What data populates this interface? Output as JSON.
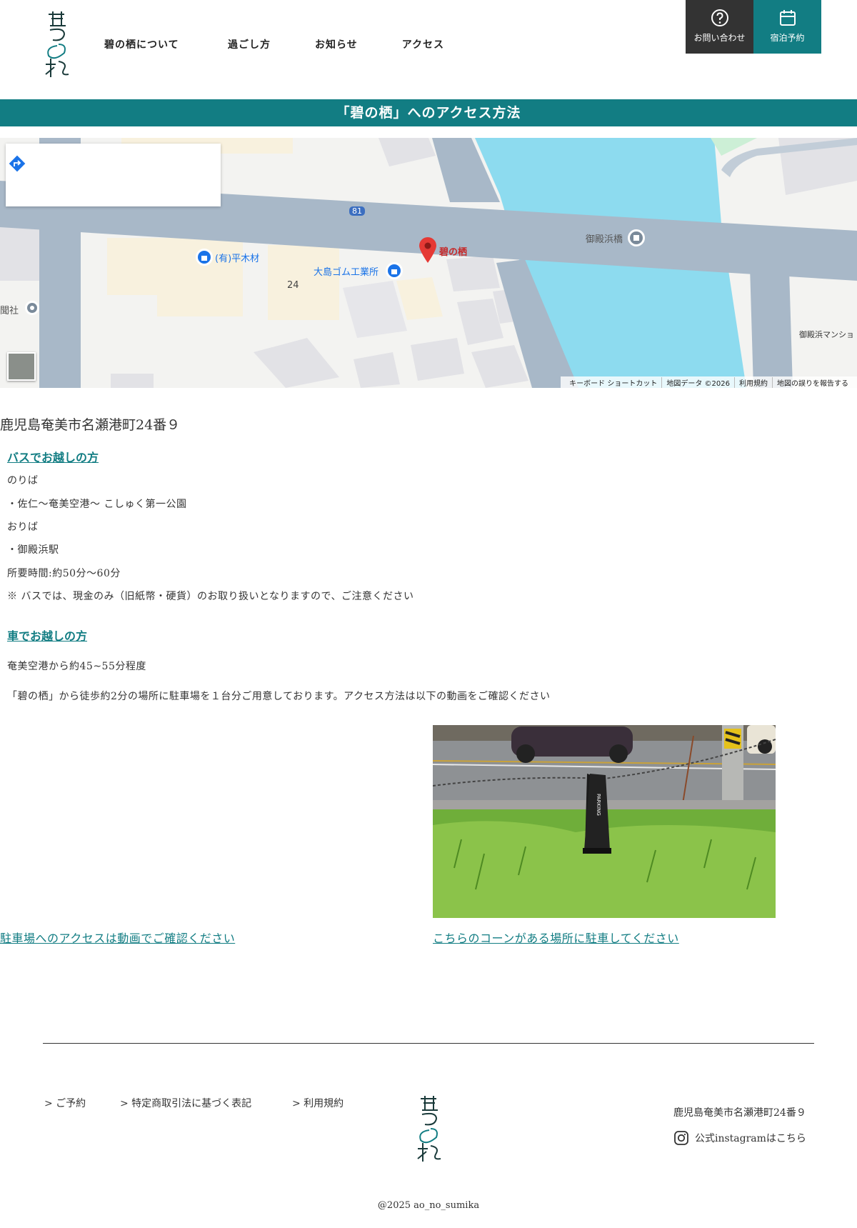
{
  "header": {
    "logo_alt": "碧の栖",
    "nav": [
      "碧の栖について",
      "過ごし方",
      "お知らせ",
      "アクセス"
    ],
    "inquiry_label": "お問い合わせ",
    "reserve_label": "宿泊予約"
  },
  "page_title": "「碧の栖」へのアクセス方法",
  "map": {
    "pin_label": "碧の栖",
    "places": [
      "(有)平木材",
      "大島ゴム工業所",
      "御殿浜橋",
      "御殿浜マンショ",
      "聞社"
    ],
    "route_number": "81",
    "block_number": "24",
    "footer": [
      "キーボード ショートカット",
      "地図データ ©2026",
      "利用規約",
      "地図の誤りを報告する"
    ]
  },
  "address": "鹿児島奄美市名瀬港町24番９",
  "bus": {
    "heading": "バスでお越しの方",
    "lines": [
      "のりば",
      "・佐仁〜奄美空港〜 こしゅく第一公園",
      "おりば",
      "・御殿浜駅",
      "所要時間:約50分〜60分",
      "※ バスでは、現金のみ（旧紙幣・硬貨）のお取り扱いとなりますので、ご注意ください"
    ]
  },
  "car": {
    "heading": "車でお越しの方",
    "lines": [
      "奄美空港から約45~55分程度",
      "「碧の栖」から徒歩約2分の場所に駐車場を１台分ご用意しております。アクセス方法は以下の動画をご確認ください"
    ]
  },
  "video_caption": "駐車場へのアクセスは動画でご確認ください",
  "photo": {
    "cone_text": "PARKING",
    "caption": "こちらのコーンがある場所に駐車してください"
  },
  "footer": {
    "links": [
      "> ご予約",
      "> 特定商取引法に基づく表記",
      "> 利用規約"
    ],
    "address": "鹿児島奄美市名瀬港町24番９",
    "instagram_label": "公式instagramはこちら",
    "copyright": "@2025 ao_no_sumika"
  },
  "colors": {
    "brand": "#127d83",
    "dark": "#333333"
  }
}
